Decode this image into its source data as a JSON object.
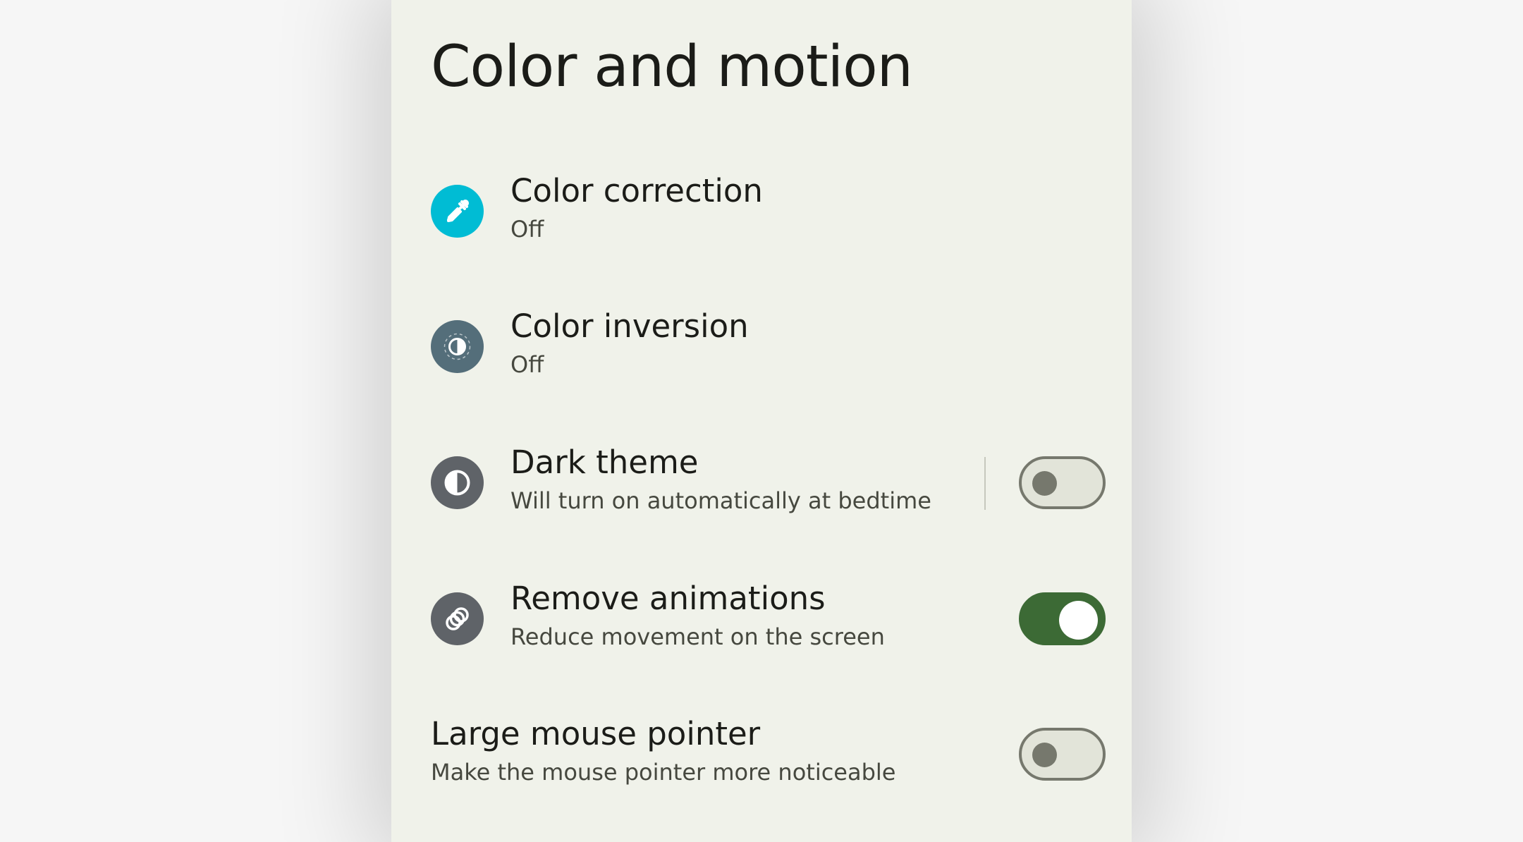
{
  "page": {
    "title": "Color and motion"
  },
  "colors": {
    "color_correction_icon_bg": "#00bcd4",
    "color_inversion_icon_bg": "#546e7a",
    "dark_theme_icon_bg": "#5f6368",
    "remove_animations_icon_bg": "#5f6368",
    "switch_on": "#3c6a35",
    "switch_off_track": "#e2e4d9"
  },
  "settings": [
    {
      "title": "Color correction",
      "subtitle": "Off",
      "icon": "eyedropper-icon"
    },
    {
      "title": "Color inversion",
      "subtitle": "Off",
      "icon": "color-inversion-icon"
    },
    {
      "title": "Dark theme",
      "subtitle": "Will turn on automatically at bedtime",
      "icon": "contrast-icon",
      "toggle": "off"
    },
    {
      "title": "Remove animations",
      "subtitle": "Reduce movement on the screen",
      "icon": "animation-icon",
      "toggle": "on"
    },
    {
      "title": "Large mouse pointer",
      "subtitle": "Make the mouse pointer more noticeable",
      "toggle": "off"
    }
  ]
}
